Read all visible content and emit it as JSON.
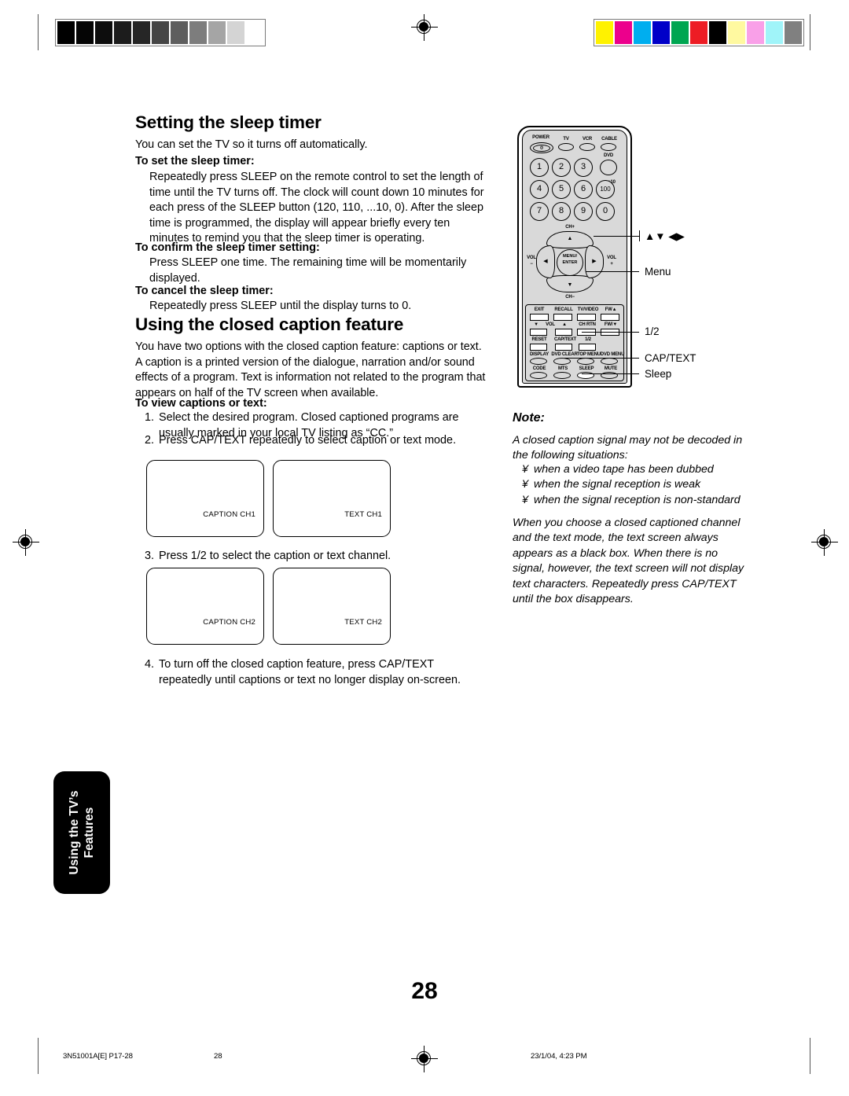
{
  "document": {
    "page_number": "28"
  },
  "sections": [
    {
      "title": "Setting the sleep timer",
      "intro": "You can set the TV so it turns off automatically.",
      "blocks": [
        {
          "heading": "To set the sleep timer:",
          "text": "Repeatedly press SLEEP on the remote control to set the length of time until the TV turns off. The clock will count down 10 minutes for each press of the SLEEP button (120, 110, ...10, 0). After the sleep time is programmed, the display will appear briefly every ten minutes to remind you that the sleep timer is operating."
        },
        {
          "heading": "To confirm the sleep timer setting:",
          "text": "Press SLEEP one time. The remaining time will be momentarily displayed."
        },
        {
          "heading": "To cancel the sleep timer:",
          "text": "Repeatedly press SLEEP until the display turns to 0."
        }
      ]
    },
    {
      "title": "Using the closed caption feature",
      "intro": "You have two options with the closed caption feature: captions or text. A caption is a printed version of the dialogue, narration and/or sound effects of a program. Text is information not related to the program that appears on half of the TV screen when available.",
      "heading": "To view captions or text:",
      "steps": [
        {
          "num": "1.",
          "text": "Select the desired program. Closed captioned programs are usually marked in your local TV listing as “CC.”"
        },
        {
          "num": "2.",
          "text": "Press CAP/TEXT repeatedly to select caption or text mode."
        },
        {
          "num": "3.",
          "text": "Press 1/2 to select the caption or text channel."
        },
        {
          "num": "4.",
          "text": "To turn off the closed caption feature, press CAP/TEXT repeatedly until captions or text no longer display on-screen."
        }
      ]
    }
  ],
  "tv_screens": [
    {
      "label": "CAPTION CH1"
    },
    {
      "label": "TEXT CH1"
    },
    {
      "label": "CAPTION CH2"
    },
    {
      "label": "TEXT CH2"
    }
  ],
  "note": {
    "title": "Note:",
    "paragraph1": "A closed caption signal may not be decoded in the following situations:",
    "bullets": [
      {
        "mark": "¥",
        "text": "when a video tape has been dubbed"
      },
      {
        "mark": "¥",
        "text": "when the signal reception is weak"
      },
      {
        "mark": "¥",
        "text": "when the signal reception is non-standard"
      }
    ],
    "paragraph2": "When you choose a closed captioned channel and the text mode, the text screen always appears as a black box. When there is no signal, however, the text screen will not display text characters. Repeatedly press CAP/TEXT until the box disappears."
  },
  "remote": {
    "top_labels": {
      "power": "POWER",
      "tv": "TV",
      "vcr": "VCR",
      "cable": "CABLE",
      "dvd": "DVD",
      "plus_ten": "+10"
    },
    "power_glyph": "Φ",
    "keypad": [
      "1",
      "2",
      "3",
      "4",
      "5",
      "6",
      "7",
      "8",
      "9",
      "0"
    ],
    "hundred_key": "100",
    "dpad": {
      "ch_up": "CH+",
      "ch_down": "CH−",
      "vol_left_top": "VOL",
      "vol_left_bottom": "−",
      "vol_right_top": "VOL",
      "vol_right_bottom": "+",
      "center_line1": "MENU/",
      "center_line2": "ENTER",
      "arrow_up": "▲",
      "arrow_down": "▼",
      "arrow_left": "◀",
      "arrow_right": "▶"
    },
    "button_rows": [
      [
        "EXIT",
        "RECALL",
        "TV/VIDEO",
        "FW▲"
      ],
      [
        "▼",
        "VOL",
        "▲",
        "CH RTN",
        "FW/▼"
      ],
      [
        "RESET",
        "CAP/TEXT",
        "1/2"
      ],
      [
        "DISPLAY",
        "DVD CLEAR",
        "TOP MENU",
        "DVD MENU"
      ],
      [
        "CODE",
        "MTS",
        "SLEEP",
        "MUTE"
      ]
    ]
  },
  "callouts": [
    {
      "label": "▲▼ ◀▶"
    },
    {
      "label": "Menu"
    },
    {
      "label": "1/2"
    },
    {
      "label": "CAP/TEXT"
    },
    {
      "label": "Sleep"
    }
  ],
  "side_tab": {
    "line1": "Using the TV’s",
    "line2": "Features"
  },
  "footer": {
    "left": "3N51001A[E] P17-28",
    "center_left": "28",
    "right": "23/1/04, 4:23 PM"
  },
  "print_marks": {
    "grayscale_swatches": [
      "#000000",
      "#050505",
      "#0d0d0d",
      "#1c1c1c",
      "#262626",
      "#454545",
      "#5e5e5e",
      "#7d7d7d",
      "#a5a5a5",
      "#d4d4d4",
      "#ffffff"
    ],
    "color_swatches": [
      "#fff200",
      "#ec008c",
      "#00aeef",
      "#0000c8",
      "#00a651",
      "#ed1c24",
      "#000000",
      "#fff9a0",
      "#f9a0e8",
      "#a0f4f9",
      "#808080"
    ]
  }
}
